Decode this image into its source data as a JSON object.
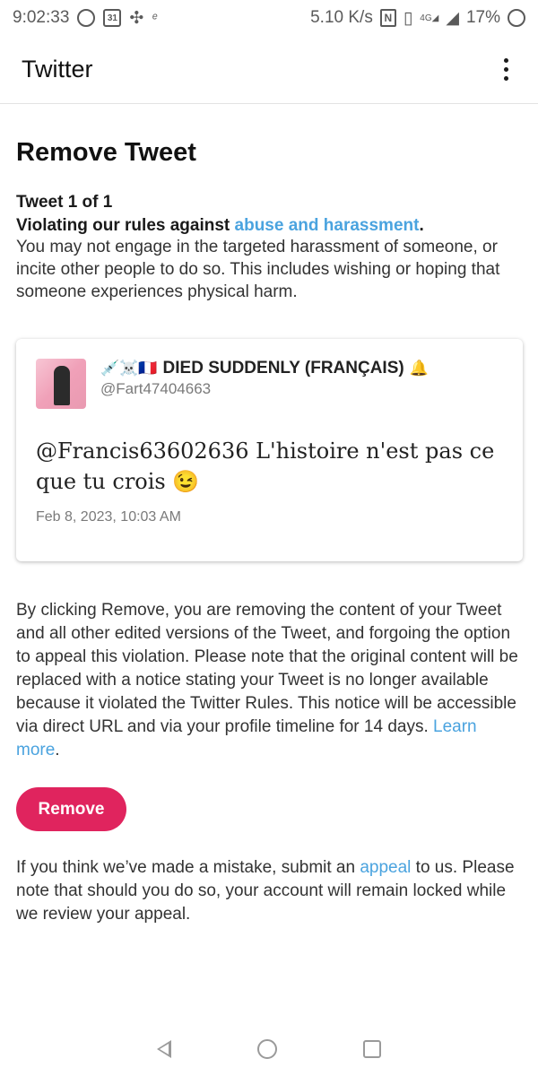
{
  "status_bar": {
    "time": "9:02:33",
    "calendar_day": "31",
    "network_speed": "5.10 K/s",
    "network_type": "4G",
    "battery": "17%"
  },
  "app_bar": {
    "title": "Twitter"
  },
  "page": {
    "title": "Remove Tweet",
    "tweet_count": "Tweet 1 of 1",
    "violation_prefix": "Violating our rules against ",
    "violation_link": "abuse and harassment",
    "violation_suffix": ".",
    "description": "You may not engage in the targeted harassment of someone, or incite other people to do so. This includes wishing or hoping that someone experiences physical harm."
  },
  "tweet": {
    "display_name": "DIED SUDDENLY (FRANÇAIS)",
    "name_prefix_emoji": "💉☠️🇫🇷",
    "name_suffix_emoji": "🔔",
    "handle": "@Fart47404663",
    "text": "@Francis63602636 L'histoire n'est pas ce que tu crois 😉",
    "date": "Feb 8, 2023, 10:03 AM"
  },
  "remove_info": {
    "text": "By clicking Remove, you are removing the content of your Tweet and all other edited versions of the Tweet, and forgoing the option to appeal this violation. Please note that the original content will be replaced with a notice stating your Tweet is no longer available because it violated the Twitter Rules. This notice will be accessible via direct URL and via your profile timeline for 14 days. ",
    "learn_more": "Learn more",
    "end": "."
  },
  "remove_button": {
    "label": "Remove"
  },
  "appeal_info": {
    "prefix": "If you think we’ve made a mistake, submit an ",
    "link": "appeal",
    "suffix": " to us. Please note that should you do so, your account will remain locked while we review your appeal."
  },
  "colors": {
    "accent_link": "#4aa3df",
    "remove_button": "#e0245e"
  }
}
